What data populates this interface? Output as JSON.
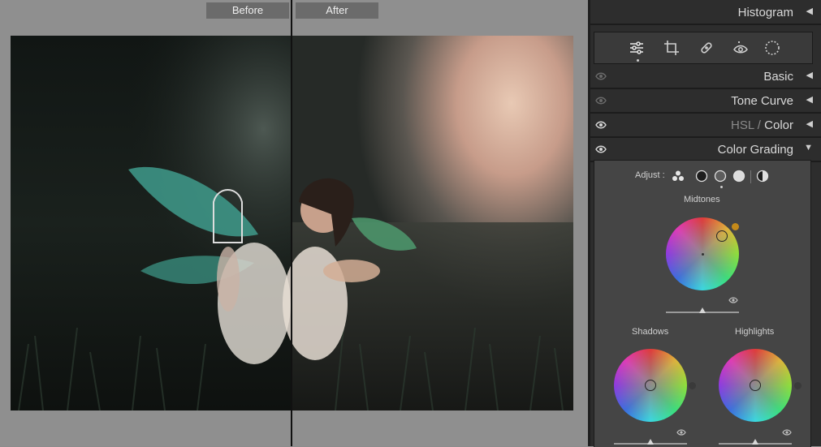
{
  "preview": {
    "before_label": "Before",
    "after_label": "After"
  },
  "panel": {
    "sections": [
      {
        "id": "histogram",
        "label": "Histogram",
        "state": "collapsed"
      },
      {
        "id": "basic",
        "label": "Basic",
        "state": "collapsed"
      },
      {
        "id": "tone_curve",
        "label": "Tone Curve",
        "state": "collapsed"
      },
      {
        "id": "hsl_color",
        "label_hsl": "HSL",
        "label_sep": " / ",
        "label_color": "Color",
        "state": "collapsed"
      },
      {
        "id": "color_grading",
        "label": "Color Grading",
        "state": "expanded"
      }
    ],
    "tools": [
      {
        "name": "edit-sliders-icon",
        "active": true
      },
      {
        "name": "crop-icon",
        "active": false
      },
      {
        "name": "healing-icon",
        "active": false
      },
      {
        "name": "red-eye-icon",
        "active": false
      },
      {
        "name": "masking-icon",
        "active": false
      }
    ],
    "color_grading": {
      "adjust_label": "Adjust :",
      "adjust_modes": [
        "3-way",
        "shadows",
        "midtones",
        "highlights",
        "global"
      ],
      "selected_mode": "midtones",
      "midtones": {
        "label": "Midtones",
        "swatch_color": "#c48a1a",
        "slider_value": 0.5
      },
      "shadows": {
        "label": "Shadows",
        "swatch_color": "#3a3a3a",
        "slider_value": 0.5
      },
      "highlights": {
        "label": "Highlights",
        "swatch_color": "#3a3a3a",
        "slider_value": 0.5
      }
    }
  },
  "colors": {
    "panel_bg": "#2d2d2d",
    "accent_swatch": "#c48a1a"
  }
}
